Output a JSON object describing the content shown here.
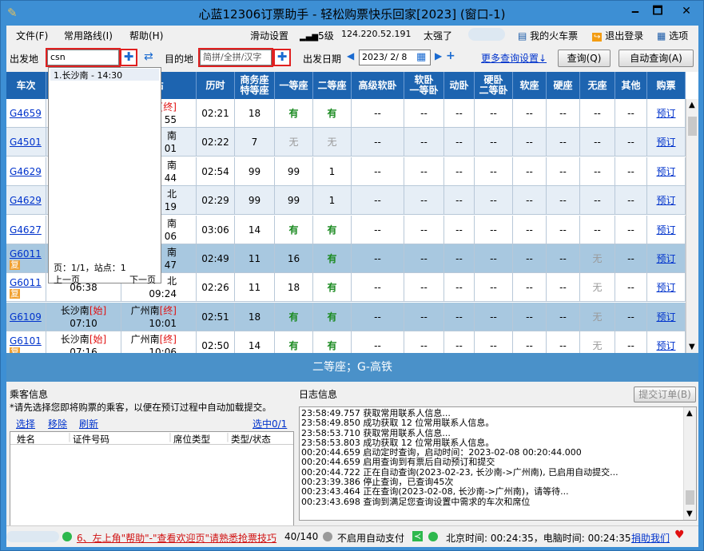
{
  "window": {
    "title": "心蓝12306订票助手 - 轻松购票快乐回家[2023] (窗口-1)",
    "controls": [
      "🗕",
      "🗖",
      "✕"
    ]
  },
  "menu": {
    "file": "文件(F)",
    "routes": "常用路线(I)",
    "help": "帮助(H)",
    "slide_settings": "滑动设置",
    "signal": "5级",
    "ip": "124.220.52.191",
    "praise": "太强了",
    "my_tickets": "我的火车票",
    "logout": "退出登录",
    "options": "选项"
  },
  "search": {
    "from_label": "出发地",
    "from_value": "csn",
    "to_label": "目的地",
    "to_placeholder": "简拼/全拼/汉字",
    "date_label": "出发日期",
    "date_value": "2023/ 2/ 8",
    "more_settings": "更多查询设置↓",
    "query_button": "查询(Q)",
    "auto_query_button": "自动查询(A)"
  },
  "suggest": {
    "item": "1.长沙南 - 14:30",
    "page_info": "页：1/1，站点：1",
    "prev": "上一页",
    "next": "下一页"
  },
  "table": {
    "headers": [
      "车次",
      "",
      "站",
      "历时",
      "商务座\n特等座",
      "一等座",
      "二等座",
      "高级软卧",
      "软卧\n一等卧",
      "动卧",
      "硬卧\n二等卧",
      "软座",
      "硬座",
      "无座",
      "其他",
      "购票"
    ],
    "rows": [
      {
        "train": "G4659",
        "fu": "",
        "from": "",
        "from_time": "",
        "to": "[终]",
        "to_time": "55",
        "dur": "02:21",
        "biz": "18",
        "first": "有",
        "second": "有",
        "no_seat": "--",
        "book": "预订"
      },
      {
        "train": "G4501",
        "fu": "",
        "from": "",
        "from_time": "",
        "to": "南",
        "to_time": "01",
        "dur": "02:22",
        "biz": "7",
        "first": "无",
        "second": "无",
        "no_seat": "--",
        "book": "预订"
      },
      {
        "train": "G4629",
        "fu": "",
        "from": "",
        "from_time": "",
        "to": "南",
        "to_time": "44",
        "dur": "02:54",
        "biz": "99",
        "first": "99",
        "second": "1",
        "no_seat": "--",
        "book": "预订"
      },
      {
        "train": "G4629",
        "fu": "",
        "from": "",
        "from_time": "",
        "to": "北",
        "to_time": "19",
        "dur": "02:29",
        "biz": "99",
        "first": "99",
        "second": "1",
        "no_seat": "--",
        "book": "预订"
      },
      {
        "train": "G4627",
        "fu": "",
        "from": "",
        "from_time": "",
        "to": "南",
        "to_time": "06",
        "dur": "03:06",
        "biz": "14",
        "first": "有",
        "second": "有",
        "no_seat": "--",
        "book": "预订"
      },
      {
        "train": "G6011",
        "fu": "复",
        "from": "",
        "from_time": "",
        "to": "南",
        "to_time": "47",
        "dur": "02:49",
        "biz": "11",
        "first": "16",
        "second": "有",
        "no_seat": "无",
        "book": "预订"
      },
      {
        "train": "G6011",
        "fu": "复",
        "from": "",
        "from_time": "06:38",
        "to": "北",
        "to_time": "09:24",
        "dur": "02:26",
        "biz": "11",
        "first": "18",
        "second": "有",
        "no_seat": "无",
        "book": "预订"
      },
      {
        "train": "G6109",
        "fu": "",
        "from": "长沙南",
        "from_mark": "[始]",
        "from_time": "07:10",
        "to": "广州南",
        "to_mark": "[终]",
        "to_time": "10:01",
        "dur": "02:51",
        "biz": "18",
        "first": "有",
        "second": "有",
        "no_seat": "无",
        "book": "预订"
      },
      {
        "train": "G6101",
        "fu": "复",
        "from": "长沙南",
        "from_mark": "[始]",
        "from_time": "07:16",
        "to": "广州南",
        "to_mark": "[终]",
        "to_time": "10:06",
        "dur": "02:50",
        "biz": "14",
        "first": "有",
        "second": "有",
        "no_seat": "无",
        "book": "预订"
      }
    ],
    "dash": "--"
  },
  "seat_bar": "二等座；G-高铁",
  "passengers": {
    "title": "乘客信息",
    "hint": "*请先选择您即将购票的乘客，以便在预订过程中自动加载提交。",
    "select": "选择",
    "remove": "移除",
    "refresh": "刷新",
    "selected": "选中0/1",
    "col_name": "姓名",
    "col_id": "证件号码",
    "col_seat": "席位类型",
    "col_type": "类型/状态"
  },
  "log": {
    "title": "日志信息",
    "submit": "提交订单(B)",
    "lines": [
      "23:58:49.757 获取常用联系人信息...",
      "23:58:49.850 成功获取 12 位常用联系人信息。",
      "23:58:53.710 获取常用联系人信息...",
      "23:58:53.803 成功获取 12 位常用联系人信息。",
      "00:20:44.659 启动定时查询，启动时间：2023-02-08 00:20:44.000",
      "00:20:44.659 启用查询到有票后自动预订和提交",
      "00:20:44.722 正在自动查询(2023-02-23, 长沙南->广州南), 已启用自动提交...",
      "00:23:39.386 停止查询，已查询45次",
      "00:23:43.464 正在查询(2023-02-08, 长沙南->广州南)，请等待...",
      "00:23:43.698 查询到满足您查询设置中需求的车次和席位"
    ]
  },
  "status": {
    "tip": "6、左上角\"帮助\"-\"查看欢迎页\"请熟悉抢票技巧",
    "count": "40/140",
    "auto_pay": "不启用自动支付",
    "beijing_time": "北京时间: 00:24:35，电脑时间: 00:24:35",
    "donate": "捐助我们"
  }
}
